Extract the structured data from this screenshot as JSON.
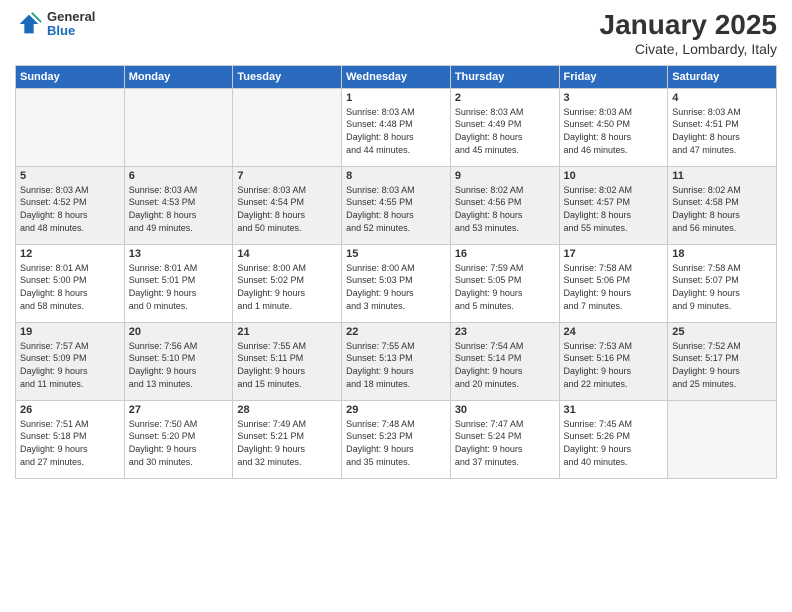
{
  "header": {
    "logo_general": "General",
    "logo_blue": "Blue",
    "title": "January 2025",
    "subtitle": "Civate, Lombardy, Italy"
  },
  "days_of_week": [
    "Sunday",
    "Monday",
    "Tuesday",
    "Wednesday",
    "Thursday",
    "Friday",
    "Saturday"
  ],
  "weeks": [
    [
      {
        "day": "",
        "content": ""
      },
      {
        "day": "",
        "content": ""
      },
      {
        "day": "",
        "content": ""
      },
      {
        "day": "1",
        "content": "Sunrise: 8:03 AM\nSunset: 4:48 PM\nDaylight: 8 hours\nand 44 minutes."
      },
      {
        "day": "2",
        "content": "Sunrise: 8:03 AM\nSunset: 4:49 PM\nDaylight: 8 hours\nand 45 minutes."
      },
      {
        "day": "3",
        "content": "Sunrise: 8:03 AM\nSunset: 4:50 PM\nDaylight: 8 hours\nand 46 minutes."
      },
      {
        "day": "4",
        "content": "Sunrise: 8:03 AM\nSunset: 4:51 PM\nDaylight: 8 hours\nand 47 minutes."
      }
    ],
    [
      {
        "day": "5",
        "content": "Sunrise: 8:03 AM\nSunset: 4:52 PM\nDaylight: 8 hours\nand 48 minutes."
      },
      {
        "day": "6",
        "content": "Sunrise: 8:03 AM\nSunset: 4:53 PM\nDaylight: 8 hours\nand 49 minutes."
      },
      {
        "day": "7",
        "content": "Sunrise: 8:03 AM\nSunset: 4:54 PM\nDaylight: 8 hours\nand 50 minutes."
      },
      {
        "day": "8",
        "content": "Sunrise: 8:03 AM\nSunset: 4:55 PM\nDaylight: 8 hours\nand 52 minutes."
      },
      {
        "day": "9",
        "content": "Sunrise: 8:02 AM\nSunset: 4:56 PM\nDaylight: 8 hours\nand 53 minutes."
      },
      {
        "day": "10",
        "content": "Sunrise: 8:02 AM\nSunset: 4:57 PM\nDaylight: 8 hours\nand 55 minutes."
      },
      {
        "day": "11",
        "content": "Sunrise: 8:02 AM\nSunset: 4:58 PM\nDaylight: 8 hours\nand 56 minutes."
      }
    ],
    [
      {
        "day": "12",
        "content": "Sunrise: 8:01 AM\nSunset: 5:00 PM\nDaylight: 8 hours\nand 58 minutes."
      },
      {
        "day": "13",
        "content": "Sunrise: 8:01 AM\nSunset: 5:01 PM\nDaylight: 9 hours\nand 0 minutes."
      },
      {
        "day": "14",
        "content": "Sunrise: 8:00 AM\nSunset: 5:02 PM\nDaylight: 9 hours\nand 1 minute."
      },
      {
        "day": "15",
        "content": "Sunrise: 8:00 AM\nSunset: 5:03 PM\nDaylight: 9 hours\nand 3 minutes."
      },
      {
        "day": "16",
        "content": "Sunrise: 7:59 AM\nSunset: 5:05 PM\nDaylight: 9 hours\nand 5 minutes."
      },
      {
        "day": "17",
        "content": "Sunrise: 7:58 AM\nSunset: 5:06 PM\nDaylight: 9 hours\nand 7 minutes."
      },
      {
        "day": "18",
        "content": "Sunrise: 7:58 AM\nSunset: 5:07 PM\nDaylight: 9 hours\nand 9 minutes."
      }
    ],
    [
      {
        "day": "19",
        "content": "Sunrise: 7:57 AM\nSunset: 5:09 PM\nDaylight: 9 hours\nand 11 minutes."
      },
      {
        "day": "20",
        "content": "Sunrise: 7:56 AM\nSunset: 5:10 PM\nDaylight: 9 hours\nand 13 minutes."
      },
      {
        "day": "21",
        "content": "Sunrise: 7:55 AM\nSunset: 5:11 PM\nDaylight: 9 hours\nand 15 minutes."
      },
      {
        "day": "22",
        "content": "Sunrise: 7:55 AM\nSunset: 5:13 PM\nDaylight: 9 hours\nand 18 minutes."
      },
      {
        "day": "23",
        "content": "Sunrise: 7:54 AM\nSunset: 5:14 PM\nDaylight: 9 hours\nand 20 minutes."
      },
      {
        "day": "24",
        "content": "Sunrise: 7:53 AM\nSunset: 5:16 PM\nDaylight: 9 hours\nand 22 minutes."
      },
      {
        "day": "25",
        "content": "Sunrise: 7:52 AM\nSunset: 5:17 PM\nDaylight: 9 hours\nand 25 minutes."
      }
    ],
    [
      {
        "day": "26",
        "content": "Sunrise: 7:51 AM\nSunset: 5:18 PM\nDaylight: 9 hours\nand 27 minutes."
      },
      {
        "day": "27",
        "content": "Sunrise: 7:50 AM\nSunset: 5:20 PM\nDaylight: 9 hours\nand 30 minutes."
      },
      {
        "day": "28",
        "content": "Sunrise: 7:49 AM\nSunset: 5:21 PM\nDaylight: 9 hours\nand 32 minutes."
      },
      {
        "day": "29",
        "content": "Sunrise: 7:48 AM\nSunset: 5:23 PM\nDaylight: 9 hours\nand 35 minutes."
      },
      {
        "day": "30",
        "content": "Sunrise: 7:47 AM\nSunset: 5:24 PM\nDaylight: 9 hours\nand 37 minutes."
      },
      {
        "day": "31",
        "content": "Sunrise: 7:45 AM\nSunset: 5:26 PM\nDaylight: 9 hours\nand 40 minutes."
      },
      {
        "day": "",
        "content": ""
      }
    ]
  ]
}
